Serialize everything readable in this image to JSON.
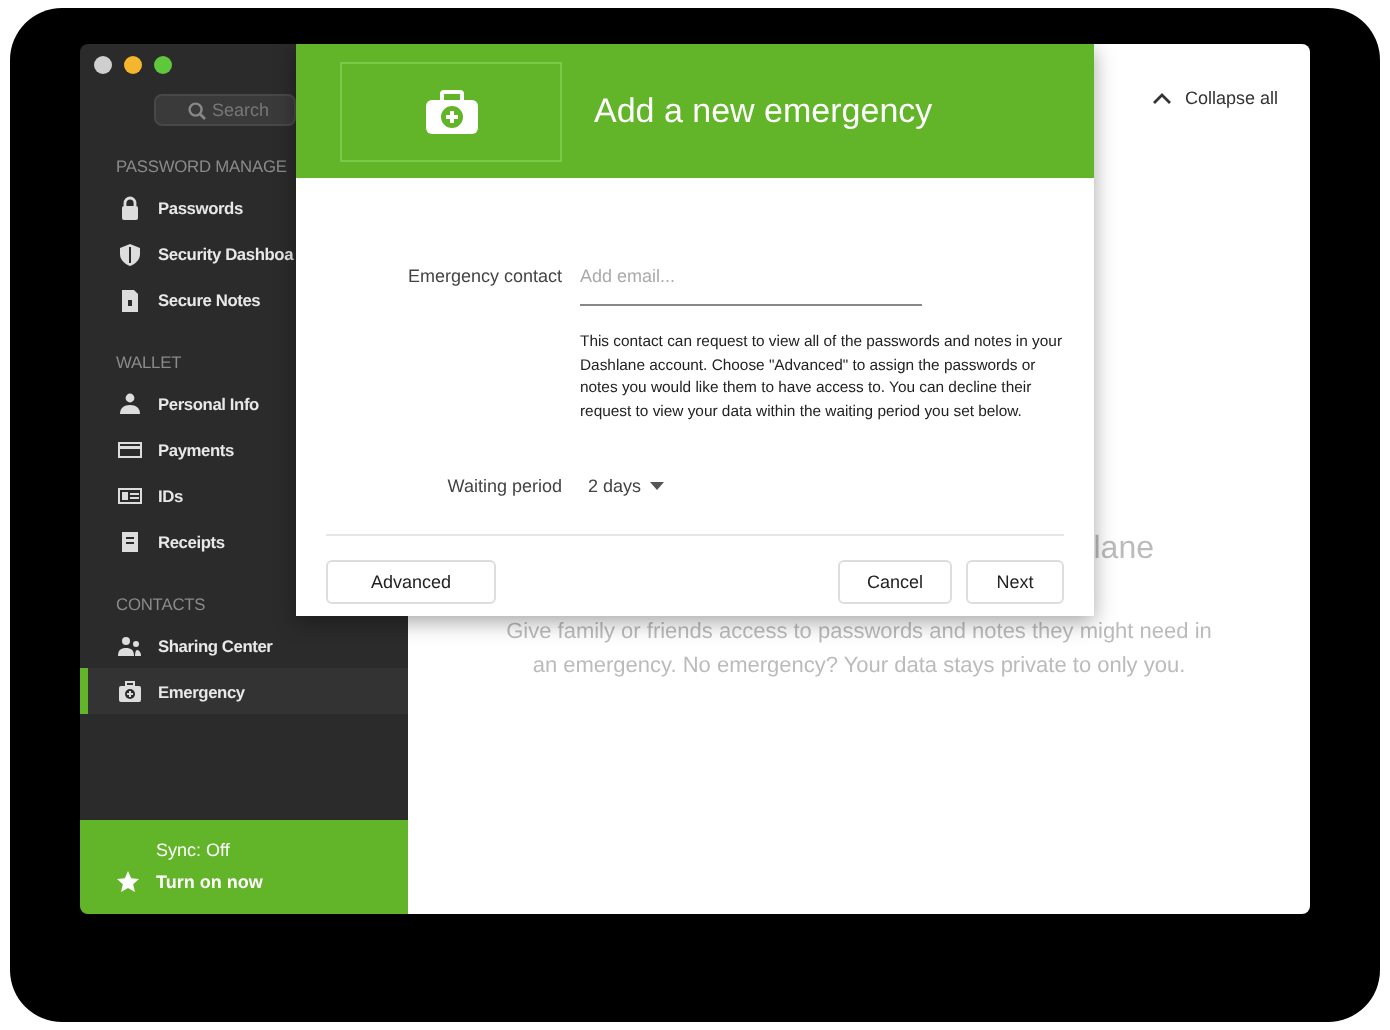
{
  "sidebar": {
    "search": {
      "placeholder": "Search"
    },
    "sections": [
      {
        "title": "PASSWORD MANAGE",
        "items": [
          {
            "label": "Passwords",
            "selected": false
          },
          {
            "label": "Security Dashboa",
            "selected": false
          },
          {
            "label": "Secure Notes",
            "selected": false
          }
        ]
      },
      {
        "title": "WALLET",
        "items": [
          {
            "label": "Personal Info",
            "selected": false
          },
          {
            "label": "Payments",
            "selected": false
          },
          {
            "label": "IDs",
            "selected": false
          },
          {
            "label": "Receipts",
            "selected": false
          }
        ]
      },
      {
        "title": "CONTACTS",
        "items": [
          {
            "label": "Sharing Center",
            "selected": false
          },
          {
            "label": "Emergency",
            "selected": true
          }
        ]
      }
    ],
    "sync": {
      "status": "Sync: Off",
      "action": "Turn on now"
    }
  },
  "main": {
    "collapse": "Collapse all",
    "heading": "lane",
    "description": "Give family or friends access to passwords and notes they might need in an emergency. No emergency? Your data stays private to only you."
  },
  "dialog": {
    "title": "Add a new emergency",
    "fields": [
      {
        "kind": "input",
        "label": "Emergency contact",
        "placeholder": "Add email..."
      },
      {
        "kind": "note",
        "text": "This contact can request to view all of the passwords and notes in your Dashlane account. Choose \"Advanced\" to assign the passwords or notes you would like them to have access to. You can decline their request to view your data within the waiting period you set below."
      },
      {
        "kind": "select",
        "label": "Waiting period",
        "value": "2 days"
      }
    ],
    "buttons": {
      "left": [
        "Advanced"
      ],
      "right": [
        "Cancel",
        "Next"
      ]
    }
  }
}
